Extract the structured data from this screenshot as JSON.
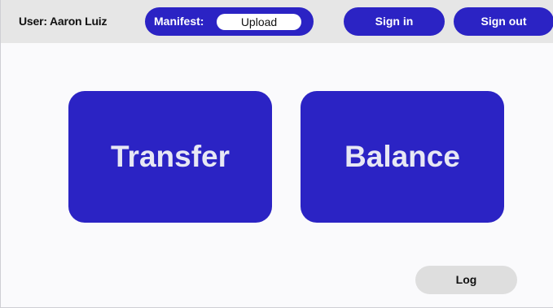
{
  "header": {
    "user_label": "User: Aaron Luiz",
    "manifest": {
      "label": "Manifest:",
      "upload_label": "Upload"
    },
    "sign_in_label": "Sign in",
    "sign_out_label": "Sign out"
  },
  "main": {
    "transfer_label": "Transfer",
    "balance_label": "Balance"
  },
  "footer": {
    "log_label": "Log"
  },
  "colors": {
    "accent": "#2b23c4",
    "topbar_background": "#e6e6e6",
    "page_background": "#fafafc",
    "log_button_background": "#dedede"
  }
}
